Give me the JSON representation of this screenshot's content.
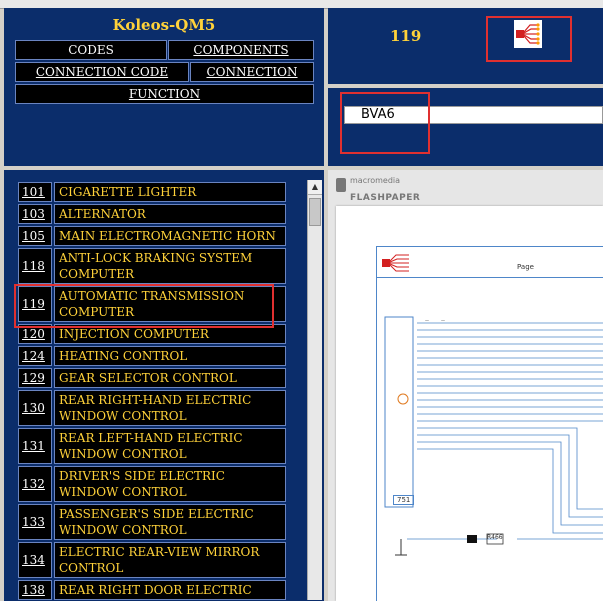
{
  "menu": {
    "title": "Koleos-QM5",
    "codes": "CODES",
    "components": "COMPONENTS",
    "connection_code": "CONNECTION CODE",
    "connection": "CONNECTION",
    "function": "FUNCTION"
  },
  "code_panel": {
    "number": "119",
    "diagram_icon": "wiring-diagram-icon"
  },
  "variant": {
    "value": "BVA6"
  },
  "viewer": {
    "brand_top": "macromedia",
    "brand_bottom": "FLASHPAPER",
    "page_label": "Page",
    "component_code": "751",
    "connector_label": "R466"
  },
  "components": [
    {
      "num": "101",
      "label": "CIGARETTE LIGHTER"
    },
    {
      "num": "103",
      "label": "ALTERNATOR"
    },
    {
      "num": "105",
      "label": "MAIN ELECTROMAGNETIC HORN"
    },
    {
      "num": "118",
      "label": "ANTI-LOCK BRAKING SYSTEM COMPUTER"
    },
    {
      "num": "119",
      "label": "AUTOMATIC TRANSMISSION COMPUTER"
    },
    {
      "num": "120",
      "label": "INJECTION COMPUTER"
    },
    {
      "num": "124",
      "label": "HEATING CONTROL"
    },
    {
      "num": "129",
      "label": "GEAR SELECTOR CONTROL"
    },
    {
      "num": "130",
      "label": "REAR RIGHT-HAND ELECTRIC WINDOW CONTROL"
    },
    {
      "num": "131",
      "label": "REAR LEFT-HAND ELECTRIC WINDOW CONTROL"
    },
    {
      "num": "132",
      "label": "DRIVER'S SIDE ELECTRIC WINDOW CONTROL"
    },
    {
      "num": "133",
      "label": "PASSENGER'S SIDE ELECTRIC WINDOW CONTROL"
    },
    {
      "num": "134",
      "label": "ELECTRIC REAR-VIEW MIRROR CONTROL"
    },
    {
      "num": "138",
      "label": "REAR RIGHT DOOR ELECTRIC"
    }
  ],
  "colors": {
    "panel": "#0b2d6b",
    "accent": "#ffd23a",
    "highlight": "#e03030",
    "wire": "#4e86c9"
  }
}
